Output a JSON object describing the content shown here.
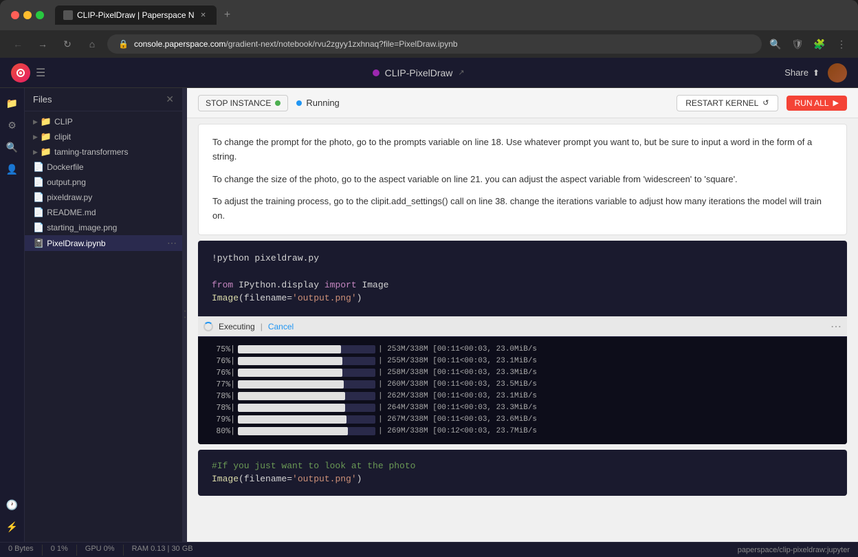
{
  "browser": {
    "tab_title": "CLIP-PixelDraw | Paperspace N",
    "address": "console.paperspace.com/gradient-next/notebook/rvu2zgyy1zxhnaq?file=PixelDraw.ipynb",
    "address_display": "console.paperspace.com",
    "address_path": "/gradient-next/notebook/rvu2zgyy1zxhnaq?file=PixelDraw.ipynb"
  },
  "app": {
    "title": "CLIP-PixelDraw",
    "share_label": "Share",
    "running_status": "Running",
    "stop_instance_label": "STOP INSTANCE",
    "restart_kernel_label": "RESTART KERNEL",
    "run_all_label": "RUN ALL"
  },
  "file_panel": {
    "title": "Files",
    "items": [
      {
        "name": "CLIP",
        "type": "folder",
        "indent": 0
      },
      {
        "name": "clipit",
        "type": "folder",
        "indent": 0
      },
      {
        "name": "taming-transformers",
        "type": "folder",
        "indent": 0
      },
      {
        "name": "Dockerfile",
        "type": "file",
        "indent": 0
      },
      {
        "name": "output.png",
        "type": "file",
        "indent": 0
      },
      {
        "name": "pixeldraw.py",
        "type": "file",
        "indent": 0
      },
      {
        "name": "README.md",
        "type": "file",
        "indent": 0
      },
      {
        "name": "starting_image.png",
        "type": "file",
        "indent": 0
      },
      {
        "name": "PixelDraw.ipynb",
        "type": "notebook",
        "indent": 0,
        "active": true
      }
    ]
  },
  "notebook": {
    "text_paragraphs": [
      "To change the prompt for the photo, go to the prompts variable on line 18. Use whatever prompt you want to, but be sure to input a word in the form of a string.",
      "To change the size of the photo, go to the aspect variable on line 21. you can adjust the aspect variable from 'widescreen' to 'square'.",
      "To adjust the training process, go to the clipit.add_settings() call on line 38. change the iterations variable to adjust how many iterations the model will train on."
    ],
    "code_lines": [
      "!python pixeldraw.py",
      "",
      "from IPython.display import Image",
      "Image(filename='output.png')"
    ],
    "executing_label": "Executing",
    "cancel_label": "Cancel",
    "progress_rows": [
      {
        "pct": "75%",
        "fill": 75,
        "stats": "| 253M/338M [00:11<00:03, 23.0MiB/s"
      },
      {
        "pct": "76%",
        "fill": 76,
        "stats": "| 255M/338M [00:11<00:03, 23.1MiB/s"
      },
      {
        "pct": "76%",
        "fill": 76,
        "stats": "| 258M/338M [00:11<00:03, 23.3MiB/s"
      },
      {
        "pct": "77%",
        "fill": 77,
        "stats": "| 260M/338M [00:11<00:03, 23.5MiB/s"
      },
      {
        "pct": "78%",
        "fill": 78,
        "stats": "| 262M/338M [00:11<00:03, 23.1MiB/s"
      },
      {
        "pct": "78%",
        "fill": 78,
        "stats": "| 264M/338M [00:11<00:03, 23.3MiB/s"
      },
      {
        "pct": "79%",
        "fill": 79,
        "stats": "| 267M/338M [00:11<00:03, 23.6MiB/s"
      },
      {
        "pct": "80%",
        "fill": 80,
        "stats": "| 269M/338M [00:12<00:03, 23.7MiB/s"
      }
    ],
    "bottom_code_lines": [
      "#If you just want to look at the photo",
      "Image(filename='output.png')"
    ]
  },
  "status_bar": {
    "bytes": "0 Bytes",
    "cpu": "0 1%",
    "gpu": "GPU 0%",
    "ram": "RAM 0.13 | 30 GB",
    "kernel": "paperspace/clip-pixeldraw:jupyter"
  }
}
